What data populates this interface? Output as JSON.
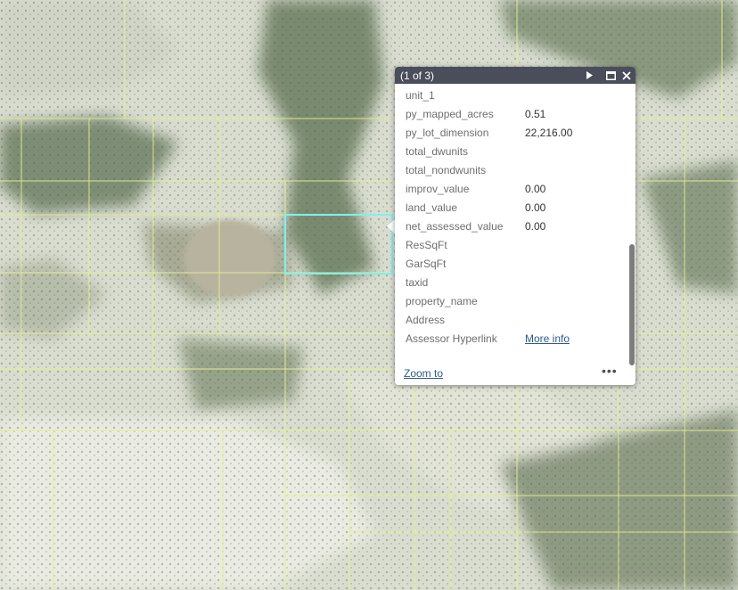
{
  "popup": {
    "title": "(1 of 3)",
    "next_icon": "play-icon",
    "maximize_icon": "window-icon",
    "close_icon": "close-icon",
    "fields": [
      {
        "key": "unit_1",
        "value": ""
      },
      {
        "key": "py_mapped_acres",
        "value": "0.51"
      },
      {
        "key": "py_lot_dimension",
        "value": "22,216.00"
      },
      {
        "key": "total_dwunits",
        "value": ""
      },
      {
        "key": "total_nondwunits",
        "value": ""
      },
      {
        "key": "improv_value",
        "value": "0.00"
      },
      {
        "key": "land_value",
        "value": "0.00"
      },
      {
        "key": "net_assessed_value",
        "value": "0.00"
      },
      {
        "key": "ResSqFt",
        "value": ""
      },
      {
        "key": "GarSqFt",
        "value": ""
      },
      {
        "key": "taxid",
        "value": ""
      },
      {
        "key": "property_name",
        "value": ""
      },
      {
        "key": "Address",
        "value": ""
      },
      {
        "key": "Assessor Hyperlink",
        "value": "More info"
      }
    ],
    "footer": {
      "zoom_label": "Zoom to",
      "more_label": "•••"
    }
  },
  "colors": {
    "header_bg": "#4a4e5a",
    "parcel_line": "#e6f08c",
    "selection": "#7ff0f0",
    "link": "#2d5a8c"
  }
}
